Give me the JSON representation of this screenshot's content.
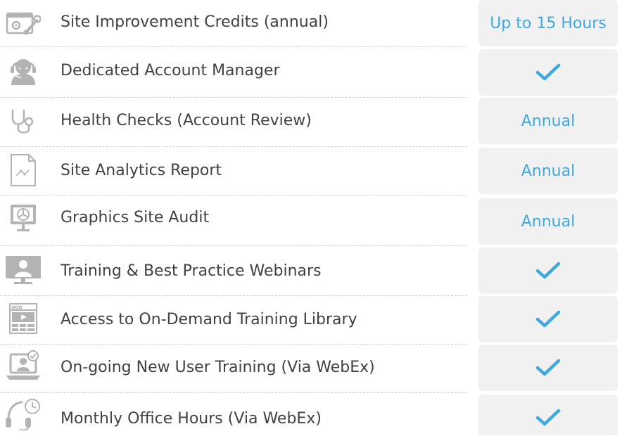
{
  "colors": {
    "accent": "#3fa9dd",
    "text": "#414141",
    "icon": "#b3b3b3",
    "cell_bg": "#f1f1f1",
    "divider": "#cfcfcf"
  },
  "rows": [
    {
      "label": "Site Improvement Credits (annual)",
      "value": "Up to 15 Hours",
      "icon": "settings-wrench-icon"
    },
    {
      "label": "Dedicated Account Manager",
      "value": "included",
      "icon": "headset-agent-icon"
    },
    {
      "label": "Health Checks (Account Review)",
      "value": "Annual",
      "icon": "stethoscope-icon"
    },
    {
      "label": "Site Analytics Report",
      "value": "Annual",
      "icon": "report-document-icon"
    },
    {
      "label": "Graphics Site Audit",
      "value": "Annual",
      "icon": "monitor-pie-chart-icon"
    },
    {
      "label": "Training & Best Practice Webinars",
      "value": "included",
      "icon": "webinar-presenter-icon"
    },
    {
      "label": "Access to On-Demand Training Library",
      "value": "included",
      "icon": "video-library-icon"
    },
    {
      "label": "On-going New User Training (Via WebEx)",
      "value": "included",
      "icon": "laptop-user-check-icon"
    },
    {
      "label": "Monthly Office Hours (Via WebEx)",
      "value": "included",
      "icon": "headset-clock-icon"
    }
  ]
}
